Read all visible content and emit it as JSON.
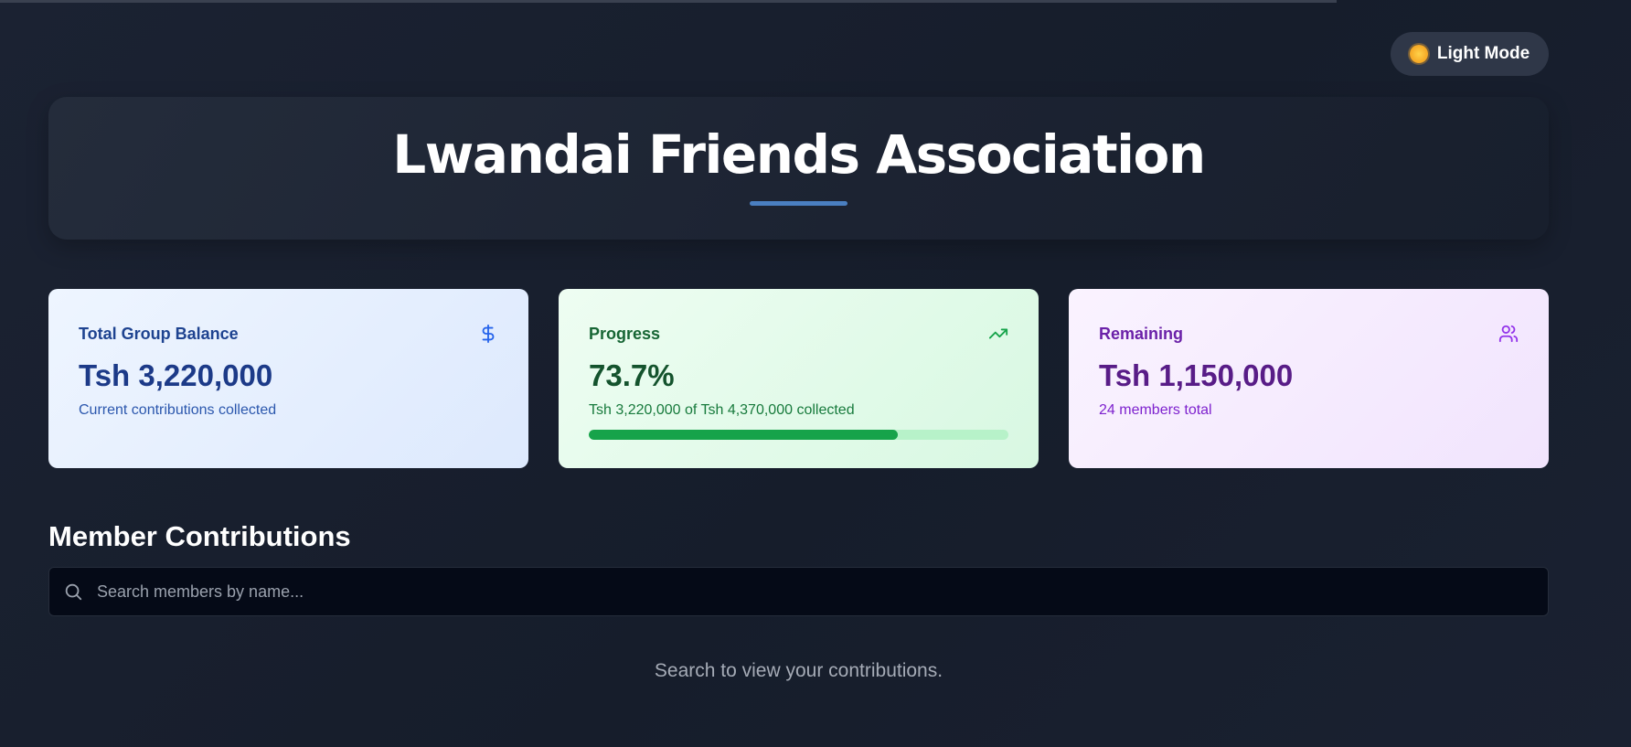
{
  "theme_toggle": {
    "label": "Light Mode",
    "icon": "sun-icon"
  },
  "header": {
    "title": "Lwandai Friends Association"
  },
  "cards": [
    {
      "title": "Total Group Balance",
      "value": "Tsh 3,220,000",
      "subtitle": "Current contributions collected",
      "icon": "dollar-icon",
      "accent": "#1e4390"
    },
    {
      "title": "Progress",
      "value": "73.7%",
      "subtitle": "Tsh 3,220,000 of Tsh 4,370,000 collected",
      "icon": "trending-up-icon",
      "accent": "#16a34a",
      "progress_fraction": 0.737
    },
    {
      "title": "Remaining",
      "value": "Tsh 1,150,000",
      "subtitle": "24 members total",
      "icon": "users-icon",
      "accent": "#6b21a8"
    }
  ],
  "members": {
    "section_title": "Member Contributions",
    "search_placeholder": "Search members by name...",
    "empty_message": "Search to view your contributions."
  },
  "colors": {
    "background": "#161d2b",
    "hero_underline": "#4a7fc1",
    "progress_track": "#b7f2c9"
  }
}
